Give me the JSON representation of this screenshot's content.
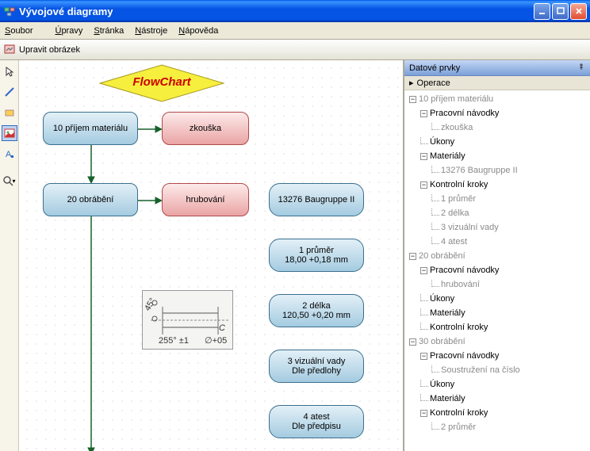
{
  "window": {
    "title": "Vývojové diagramy"
  },
  "menu": {
    "file": "Soubor",
    "file_u": "S",
    "edit": "Úpravy",
    "edit_u": "Ú",
    "page": "Stránka",
    "page_u": "S",
    "tools": "Nástroje",
    "tools_u": "N",
    "help": "Nápověda",
    "help_u": "N"
  },
  "toolbar": {
    "edit_image": "Upravit obrázek"
  },
  "flowchart": {
    "title": "FlowChart",
    "node10": "10 příjem materiálu",
    "node10_test": "zkouška",
    "node20": "20 obrábění",
    "node20_op": "hrubování",
    "material": "13276  Baugruppe II",
    "k1_a": "1 průměr",
    "k1_b": "18,00 +0,18 mm",
    "k2_a": "2 délka",
    "k2_b": "120,50 +0,20 mm",
    "k3_a": "3 vizuální vady",
    "k3_b": "Dle předlohy",
    "k4_a": "4 atest",
    "k4_b": "Dle předpisu"
  },
  "panel": {
    "title": "Datové prvky",
    "operations": "Operace"
  },
  "tree": {
    "n10": "10 příjem materiálu",
    "n10_pn": "Pracovní návodky",
    "n10_zk": "zkouška",
    "n10_uk": "Úkony",
    "n10_mat": "Materiály",
    "n10_mat1": "13276  Baugruppe II",
    "n10_kk": "Kontrolní kroky",
    "n10_k1": "1 průměr",
    "n10_k2": "2 délka",
    "n10_k3": "3 vizuální vady",
    "n10_k4": "4 atest",
    "n20": "20 obrábění",
    "n20_pn": "Pracovní návodky",
    "n20_hr": "hrubování",
    "n20_uk": "Úkony",
    "n20_mat": "Materiály",
    "n20_kk": "Kontrolní kroky",
    "n30": "30 obrábění",
    "n30_pn": "Pracovní návodky",
    "n30_so": "Soustružení na číslo",
    "n30_uk": "Úkony",
    "n30_mat": "Materiály",
    "n30_kk": "Kontrolní kroky",
    "n30_k2": "2 průměr"
  }
}
